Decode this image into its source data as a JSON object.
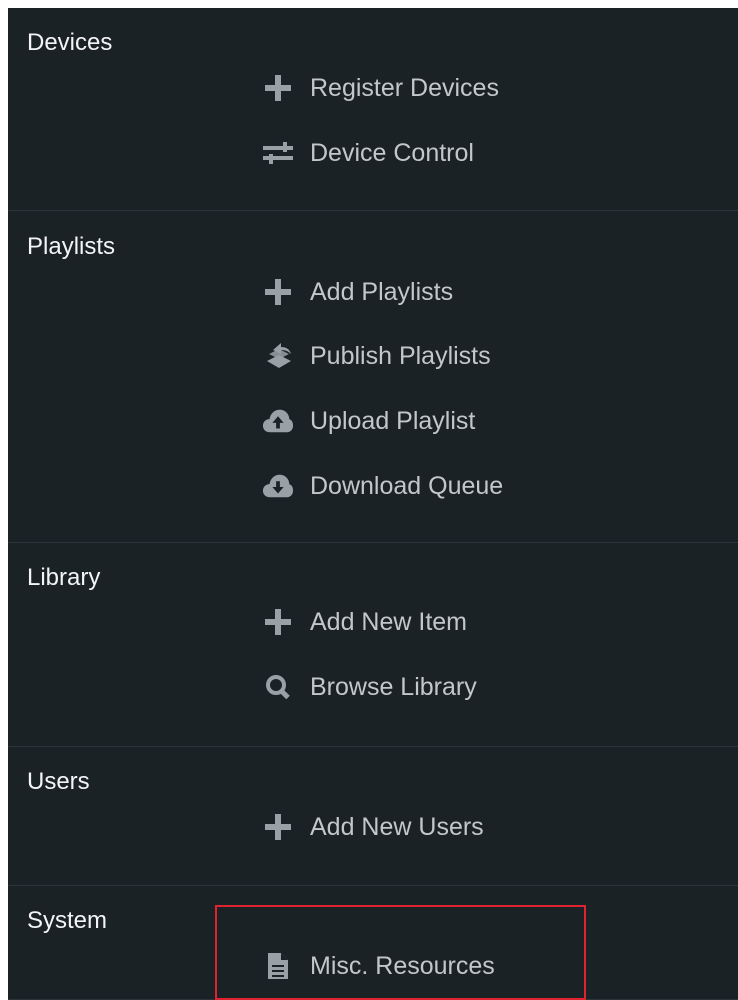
{
  "sections": [
    {
      "title": "Devices",
      "items": [
        {
          "label": "Register Devices",
          "icon": "plus-icon"
        },
        {
          "label": "Device Control",
          "icon": "sliders-icon"
        }
      ]
    },
    {
      "title": "Playlists",
      "items": [
        {
          "label": "Add Playlists",
          "icon": "plus-icon"
        },
        {
          "label": "Publish Playlists",
          "icon": "publish-icon"
        },
        {
          "label": "Upload Playlist",
          "icon": "cloud-upload-icon"
        },
        {
          "label": "Download Queue",
          "icon": "cloud-download-icon"
        }
      ]
    },
    {
      "title": "Library",
      "items": [
        {
          "label": "Add New Item",
          "icon": "plus-icon"
        },
        {
          "label": "Browse Library",
          "icon": "search-icon"
        }
      ]
    },
    {
      "title": "Users",
      "items": [
        {
          "label": "Add New Users",
          "icon": "plus-icon"
        }
      ]
    },
    {
      "title": "System",
      "items": [
        {
          "label": "Misc. Resources",
          "icon": "document-icon"
        }
      ]
    }
  ],
  "colors": {
    "background": "#1b2226",
    "heading": "#f2f4f5",
    "item_text": "#c2c7ca",
    "icon": "#9aa1a6",
    "divider": "#2d3439",
    "highlight": "#e1222f"
  }
}
